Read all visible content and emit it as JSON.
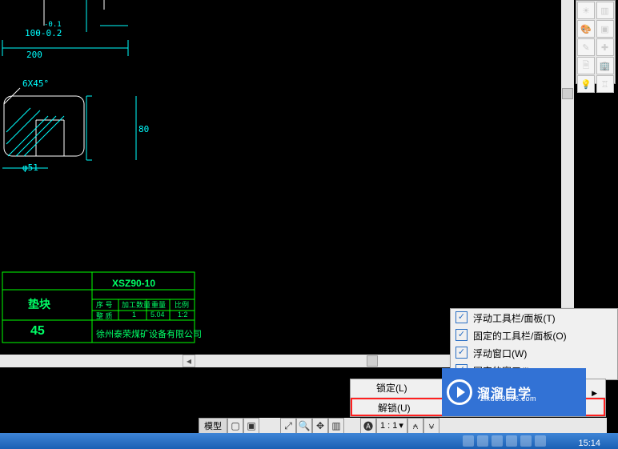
{
  "drawing": {
    "dims": {
      "d200": "200",
      "tol": "10θ-0.2",
      "tol_upper": "-0.1",
      "chamfer": "6X45°",
      "d80": "80",
      "dphi51": "φ51"
    },
    "titleblock": {
      "partname": "垫块",
      "matnum": "45",
      "code": "XSZ90-10",
      "hdr_xuhao": "序 号",
      "hdr_jiagong": "加工数量",
      "hdr_zhong": "重量",
      "hdr_bili": "比例",
      "v_xuhao": "整  质",
      "v_jiagong": "1",
      "v_zhong": "5.04",
      "v_bili": "1:2",
      "company": "徐州泰荣煤矿设备有限公司"
    }
  },
  "right_toolbar": {
    "icons": [
      "sun-icon",
      "brick-icon",
      "palette-icon",
      "cube-icon",
      "pen-icon",
      "plus-icon",
      "doc-icon",
      "building-icon",
      "bulb-icon",
      "pagoda-icon"
    ]
  },
  "context_menu": {
    "items": [
      {
        "label": "浮动工具栏/面板(T)",
        "checked": true
      },
      {
        "label": "固定的工具栏/面板(O)",
        "checked": true
      },
      {
        "label": "浮动窗口(W)",
        "checked": true
      },
      {
        "label": "固定的窗口(I)",
        "checked": true
      }
    ]
  },
  "submenu": {
    "lock": "锁定(L)",
    "unlock": "解锁(U)"
  },
  "watermark": {
    "brand": "溜溜自学",
    "url": "zixue.3d66.com"
  },
  "status": {
    "tab_model": "模型",
    "scale": "1 : 1"
  },
  "taskbar": {
    "clock": "15:14"
  }
}
